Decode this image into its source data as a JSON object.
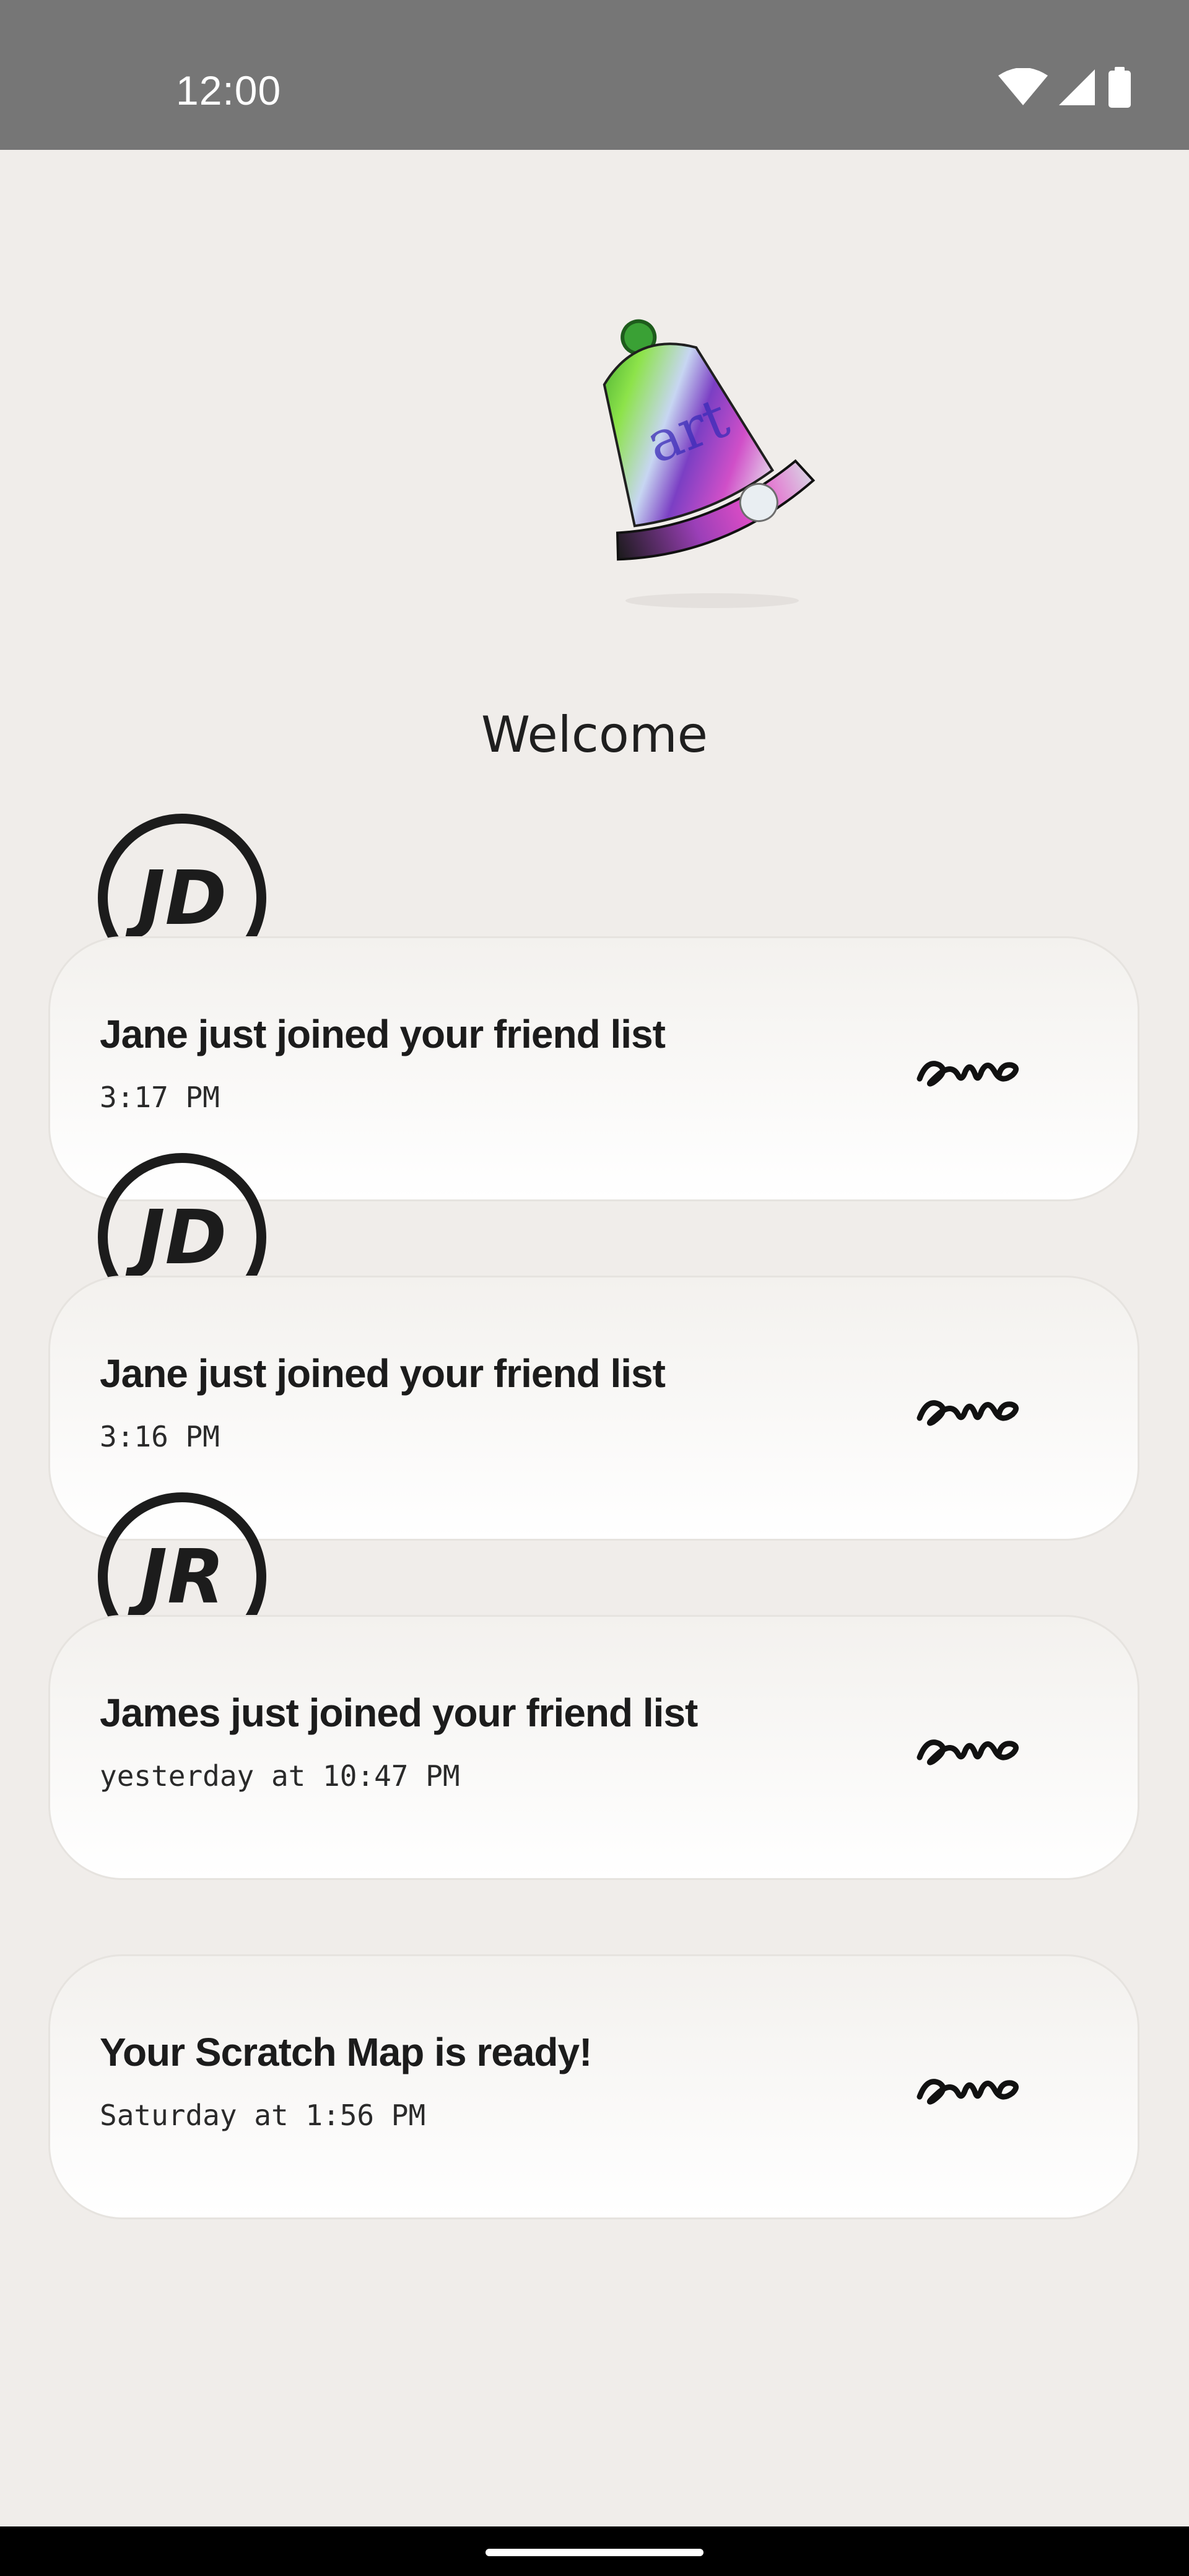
{
  "status_bar": {
    "time": "12:00",
    "icons": [
      "wifi-icon",
      "signal-icon",
      "battery-icon"
    ]
  },
  "header": {
    "bell_icon": "bell-icon",
    "title": "Welcome"
  },
  "notifications": [
    {
      "avatar_initials": "JD",
      "title": "Jane just joined your friend list",
      "time": "3:17 PM",
      "logo": "amo-logo"
    },
    {
      "avatar_initials": "JD",
      "title": "Jane just joined your friend list",
      "time": "3:16 PM",
      "logo": "amo-logo"
    },
    {
      "avatar_initials": "JR",
      "title": "James just joined your friend list",
      "time": "yesterday at 10:47 PM",
      "logo": "amo-logo"
    },
    {
      "avatar_initials": "",
      "title": "Your Scratch Map is ready!",
      "time": "Saturday at 1:56 PM",
      "logo": "amo-logo"
    }
  ],
  "colors": {
    "background": "#f0edea",
    "status_bar": "#767676",
    "card_border": "#e6e3df",
    "text": "#1c1c1c"
  }
}
